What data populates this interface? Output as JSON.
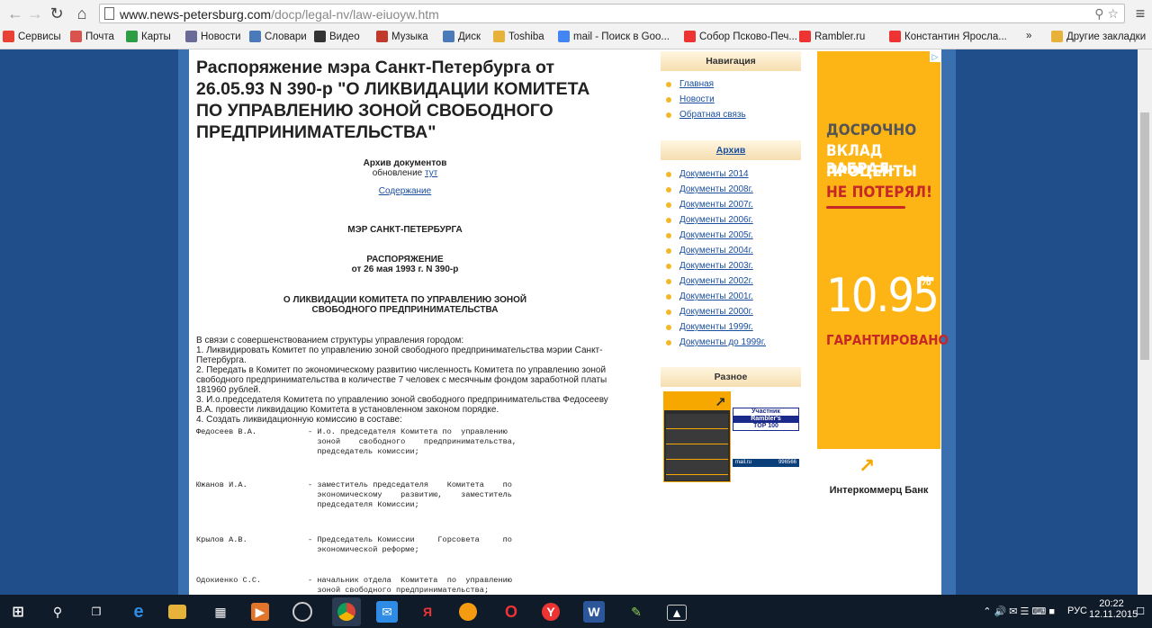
{
  "browser": {
    "url_host": "www.news-petersburg.com",
    "url_path": "/docp/legal-nv/law-eiuoyw.htm",
    "bookmarks": [
      {
        "label": "Сервисы",
        "icon": "apps-icon",
        "color": "#e94235"
      },
      {
        "label": "Почта",
        "icon": "mail-icon",
        "color": "#d9534f"
      },
      {
        "label": "Карты",
        "icon": "maps-icon",
        "color": "#2e9e44"
      },
      {
        "label": "Новости",
        "icon": "news-icon",
        "color": "#6b6b9a"
      },
      {
        "label": "Словари",
        "icon": "dict-icon",
        "color": "#4a7ab8"
      },
      {
        "label": "Видео",
        "icon": "video-icon",
        "color": "#333"
      },
      {
        "label": "Музыка",
        "icon": "music-icon",
        "color": "#c0392b"
      },
      {
        "label": "Диск",
        "icon": "disk-icon",
        "color": "#4a7ab8"
      },
      {
        "label": "Toshiba",
        "icon": "folder-icon",
        "color": "#e6b23a"
      },
      {
        "label": "mail - Поиск в Goo...",
        "icon": "google-icon",
        "color": "#4285f4"
      },
      {
        "label": "Собор Псково-Печ...",
        "icon": "yandex-icon",
        "color": "#e33"
      },
      {
        "label": "Rambler.ru",
        "icon": "yandex-icon",
        "color": "#e33"
      },
      {
        "label": "Константин Яросла...",
        "icon": "yandex-icon",
        "color": "#e33"
      }
    ],
    "more_bookmarks": "»",
    "other_bookmarks": "Другие закладки"
  },
  "doc": {
    "title": "Распоряжение мэра Санкт-Петербурга от 26.05.93 N 390-р \"О ЛИКВИДАЦИИ КОМИТЕТА ПО УПРАВЛЕНИЮ ЗОНОЙ СВОБОДНОГО ПРЕДПРИНИМАТЕЛЬСТВА\"",
    "archive_label": "Архив документов",
    "update_text": "обновление",
    "update_link": "тут",
    "contents_link": "Содержание",
    "mayor": "МЭР САНКТ-ПЕТЕРБУРГА",
    "order_title": "РАСПОРЯЖЕНИЕ",
    "order_date": "от 26 мая 1993 г. N 390-р",
    "subject_line1": "О ЛИКВИДАЦИИ КОМИТЕТА ПО УПРАВЛЕНИЮ ЗОНОЙ",
    "subject_line2": "СВОБОДНОГО ПРЕДПРИНИМАТЕЛЬСТВА",
    "paragraphs": [
      "В связи с совершенствованием структуры управления городом:",
      "1. Ликвидировать Комитет по управлению зоной свободного предпринимательства мэрии Санкт-Петербурга.",
      "2. Передать в Комитет по экономическому развитию численность Комитета по управлению зоной свободного предпринимательства в количестве 7 человек с месячным фондом заработной платы 181960 рублей.",
      "3. И.о.председателя Комитета по управлению зоной свободного предпринимательства Федосееву В.А. провести ликвидацию Комитета в установленном законом порядке.",
      "4. Создать ликвидационную комиссию в составе:"
    ],
    "members": [
      {
        "name": "Федосеев В.А.",
        "desc": "- И.о. председателя Комитета по  управлению\n  зоной    свободного    предпринимательства,\n  председатель комиссии;"
      },
      {
        "name": "Южанов И.А.",
        "desc": "- заместитель председателя    Комитета    по\n  экономическому    развитию,    заместитель\n  председателя Комиссии;"
      },
      {
        "name": "Крылов А.В.",
        "desc": "- Председатель Комиссии     Горсовета     по\n  экономической реформе;"
      },
      {
        "name": "Одокиенко С.С.",
        "desc": "- начальник отдела  Комитета  по  управлению\n  зоной свободного предпринимательства;"
      }
    ]
  },
  "sidebar": {
    "nav_title": "Навигация",
    "nav_items": [
      "Главная",
      "Новости",
      "Обратная связь"
    ],
    "archive_title": "Архив",
    "archive_items": [
      "Документы 2014",
      "Документы 2008г.",
      "Документы 2007г.",
      "Документы 2006г.",
      "Документы 2005г.",
      "Документы 2004г.",
      "Документы 2003г.",
      "Документы 2002г.",
      "Документы 2001г.",
      "Документы 2000г.",
      "Документы 1999г.",
      "Документы до 1999г."
    ],
    "misc_title": "Разное",
    "rambler_line1": "Участник",
    "rambler_line2": "Rambler's",
    "rambler_line3": "TOP 100",
    "mailru_label": "mail.ru",
    "mailru_count": "996566"
  },
  "ad": {
    "line1": "ДОСРОЧНО",
    "line2": "ВКЛАД ЗАБРАЛ-",
    "line3": "ПРОЦЕНТЫ",
    "line4": "НЕ ПОТЕРЯЛ!",
    "rate": "10.95",
    "percent": "%",
    "guarantee": "ГАРАНТИРОВАНО",
    "bank": "Интеркоммерц Банк"
  },
  "taskbar": {
    "lang": "РУС",
    "time": "20:22",
    "date": "12.11.2015"
  },
  "colors": {
    "accent": "#1a4fa0",
    "page_bg": "#1f4e8a",
    "ad_bg": "#fdb515",
    "bullet": "#f3b72a"
  }
}
